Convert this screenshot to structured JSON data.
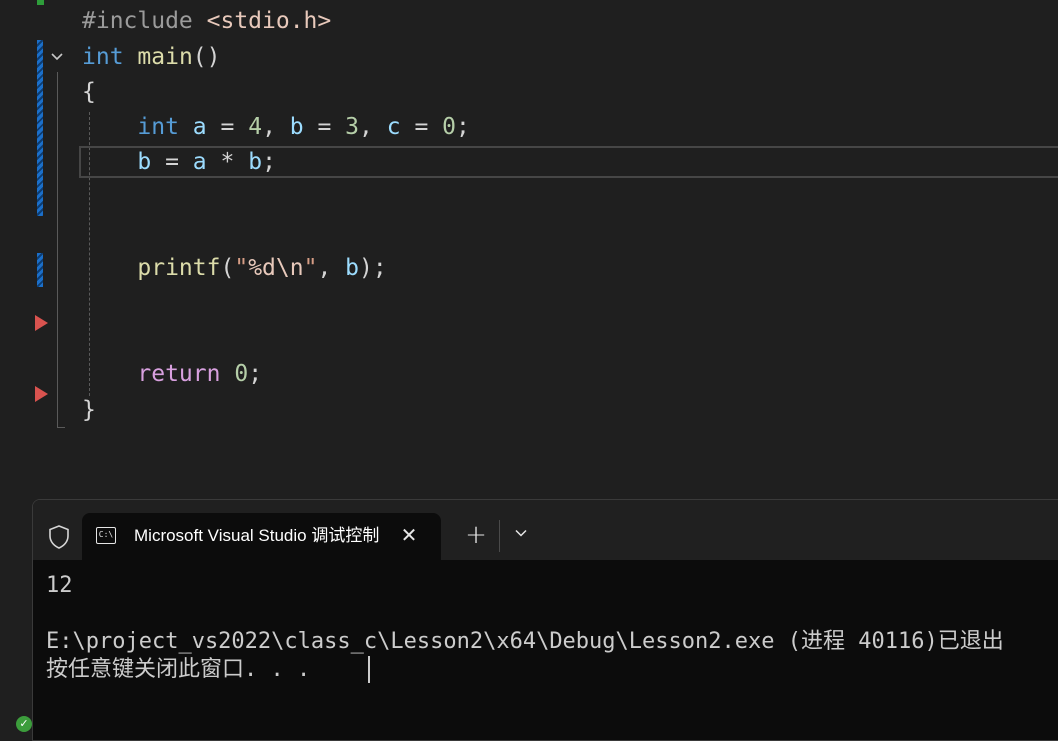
{
  "editor": {
    "lines": [
      {
        "tokens": [
          {
            "t": "#include ",
            "c": "tk-pre"
          },
          {
            "t": "<stdio.h>",
            "c": "tk-str"
          }
        ]
      },
      {
        "tokens": [
          {
            "t": "int",
            "c": "tk-kw"
          },
          {
            "t": " ",
            "c": "tk-op"
          },
          {
            "t": "main",
            "c": "tk-fn"
          },
          {
            "t": "()",
            "c": "tk-op"
          }
        ]
      },
      {
        "tokens": [
          {
            "t": "{",
            "c": "tk-op"
          }
        ]
      },
      {
        "tokens": [
          {
            "t": "    ",
            "c": "tk-op"
          },
          {
            "t": "int",
            "c": "tk-kw"
          },
          {
            "t": " ",
            "c": "tk-op"
          },
          {
            "t": "a",
            "c": "tk-var"
          },
          {
            "t": " = ",
            "c": "tk-op"
          },
          {
            "t": "4",
            "c": "tk-num"
          },
          {
            "t": ", ",
            "c": "tk-op"
          },
          {
            "t": "b",
            "c": "tk-var"
          },
          {
            "t": " = ",
            "c": "tk-op"
          },
          {
            "t": "3",
            "c": "tk-num"
          },
          {
            "t": ", ",
            "c": "tk-op"
          },
          {
            "t": "c",
            "c": "tk-var"
          },
          {
            "t": " = ",
            "c": "tk-op"
          },
          {
            "t": "0",
            "c": "tk-num"
          },
          {
            "t": ";",
            "c": "tk-op"
          }
        ]
      },
      {
        "tokens": [
          {
            "t": "    ",
            "c": "tk-op"
          },
          {
            "t": "b",
            "c": "tk-var"
          },
          {
            "t": " = ",
            "c": "tk-op"
          },
          {
            "t": "a",
            "c": "tk-var"
          },
          {
            "t": " * ",
            "c": "tk-op"
          },
          {
            "t": "b",
            "c": "tk-var"
          },
          {
            "t": ";",
            "c": "tk-op"
          }
        ]
      },
      {
        "tokens": []
      },
      {
        "tokens": []
      },
      {
        "tokens": [
          {
            "t": "    ",
            "c": "tk-op"
          },
          {
            "t": "printf",
            "c": "tk-fn"
          },
          {
            "t": "(",
            "c": "tk-op"
          },
          {
            "t": "\"",
            "c": "tk-strv"
          },
          {
            "t": "%d",
            "c": "tk-esc"
          },
          {
            "t": "\\n",
            "c": "tk-esc"
          },
          {
            "t": "\"",
            "c": "tk-strv"
          },
          {
            "t": ", ",
            "c": "tk-op"
          },
          {
            "t": "b",
            "c": "tk-var"
          },
          {
            "t": ");",
            "c": "tk-op"
          }
        ]
      },
      {
        "tokens": []
      },
      {
        "tokens": []
      },
      {
        "tokens": [
          {
            "t": "    ",
            "c": "tk-op"
          },
          {
            "t": "return",
            "c": "tk-ret"
          },
          {
            "t": " ",
            "c": "tk-op"
          },
          {
            "t": "0",
            "c": "tk-num"
          },
          {
            "t": ";",
            "c": "tk-op"
          }
        ]
      },
      {
        "tokens": [
          {
            "t": "}",
            "c": "tk-op"
          }
        ]
      }
    ],
    "fold_chevron": "⌄"
  },
  "terminal": {
    "tab_title": "Microsoft Visual Studio 调试控制台",
    "cmd_icon_text": "C:\\",
    "close_glyph": "✕",
    "new_tab_glyph": "+",
    "dropdown_glyph": "⌄",
    "output_lines": [
      "12",
      "",
      "E:\\project_vs2022\\class_c\\Lesson2\\x64\\Debug\\Lesson2.exe (进程 40116)已退出",
      "按任意键关闭此窗口. . ."
    ]
  },
  "icons": {
    "shield": "shield-icon",
    "cmd": "cmd-prompt-icon",
    "close": "close-icon",
    "add": "plus-icon",
    "dropdown": "chevron-down-icon",
    "status": "check-icon"
  },
  "colors": {
    "editor_bg": "#1f1f1f",
    "terminal_bg": "#0c0c0c",
    "keyword": "#569cd6",
    "function": "#dcdcaa",
    "variable": "#9cdcfe",
    "number": "#b5cea8",
    "control": "#d8a0df",
    "change_bar": "#1b6fc9",
    "breakpoint_arrow": "#d9534f"
  }
}
